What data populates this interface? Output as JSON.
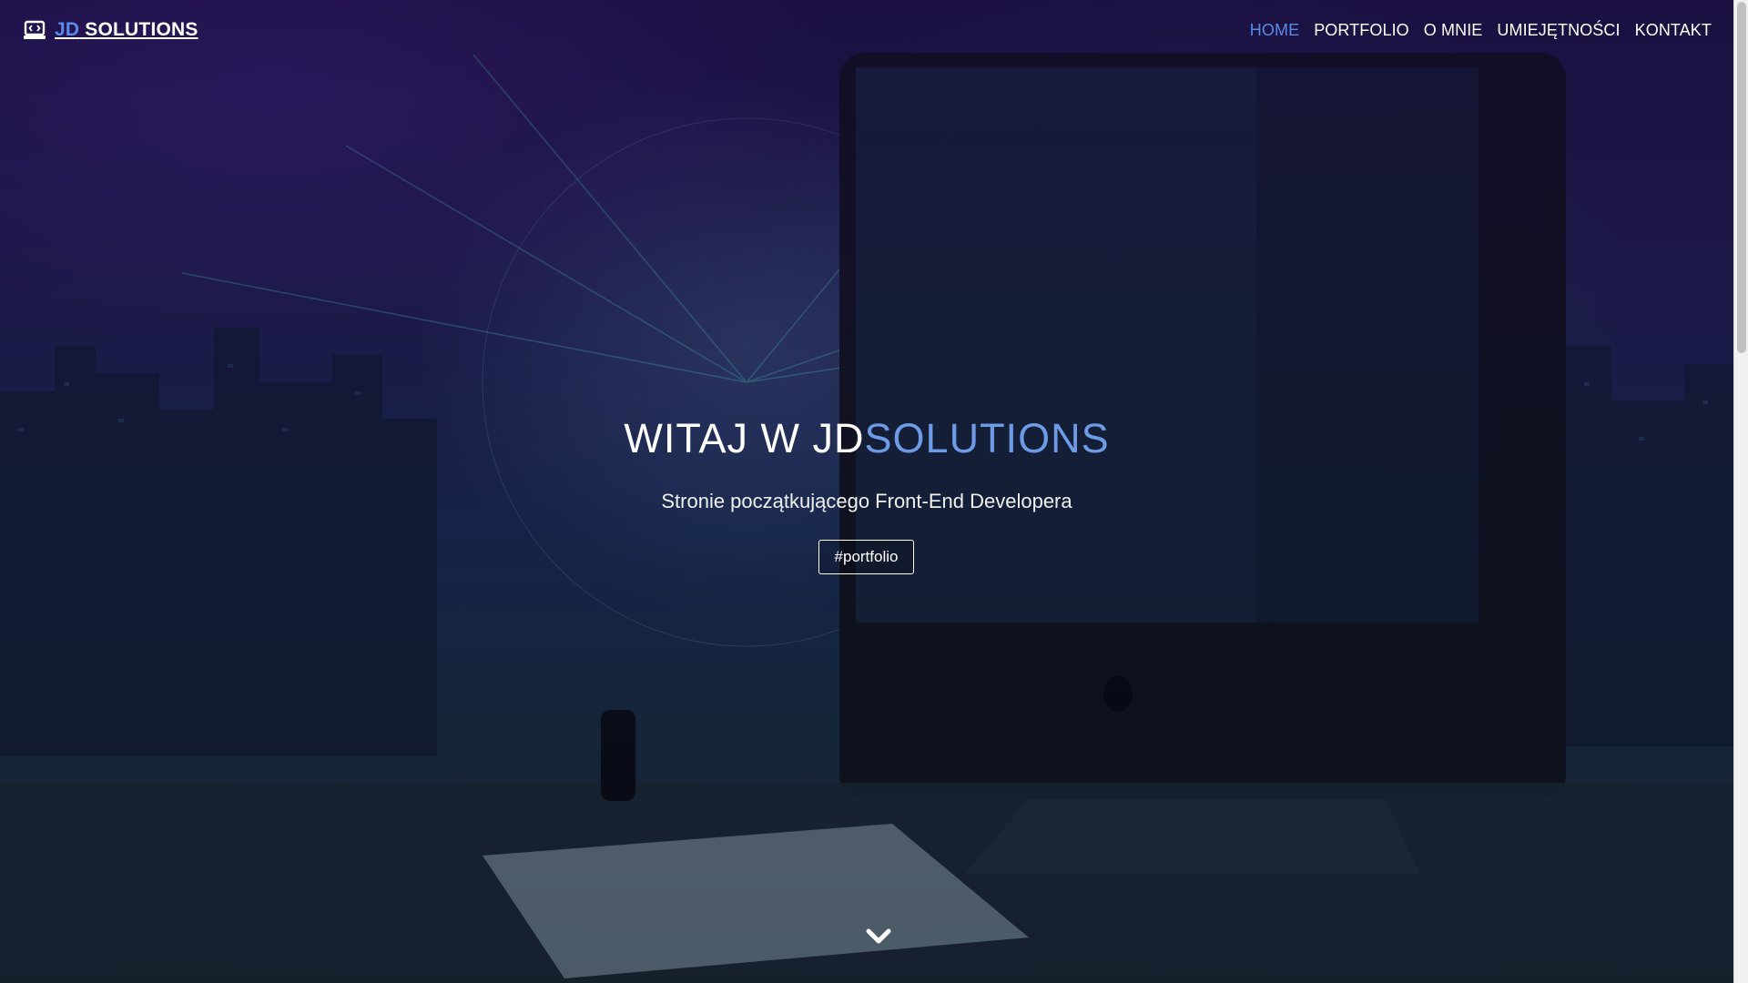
{
  "brand": {
    "icon": "laptop-code-icon",
    "accent": "JD",
    "name": " SOLUTIONS"
  },
  "nav": {
    "items": [
      {
        "label": "HOME",
        "active": true
      },
      {
        "label": "PORTFOLIO",
        "active": false
      },
      {
        "label": "O MNIE",
        "active": false
      },
      {
        "label": "UMIEJĘTNOŚCI",
        "active": false
      },
      {
        "label": "KONTAKT",
        "active": false
      }
    ]
  },
  "hero": {
    "title_plain": "WITAJ W JD",
    "title_accent": "SOLUTIONS",
    "subtitle": "Stronie początkującego Front-End Developera",
    "cta_label": "#portfolio",
    "scroll_icon": "chevron-down-icon"
  },
  "colors": {
    "accent": "#5a8be8",
    "text": "#ffffff"
  }
}
